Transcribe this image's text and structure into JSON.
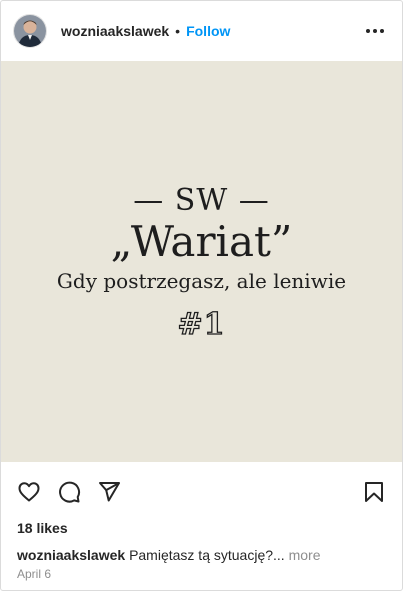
{
  "header": {
    "username": "wozniaakslawek",
    "separator": "•",
    "follow_label": "Follow"
  },
  "media": {
    "line1": "— SW —",
    "line2": "„Wariat”",
    "line3": "Gdy postrzegasz, ale leniwie",
    "line4": "#1",
    "background_color": "#e9e6da"
  },
  "actions": {
    "icons": [
      "heart-icon",
      "comment-icon",
      "share-icon",
      "bookmark-icon"
    ]
  },
  "likes": "18 likes",
  "caption": {
    "username": "wozniaakslawek",
    "text": "Pamiętasz tą sytuację?...",
    "more_label": "more"
  },
  "date": "April 6",
  "colors": {
    "accent": "#0095f6",
    "muted": "#8e8e8e",
    "text": "#262626"
  }
}
